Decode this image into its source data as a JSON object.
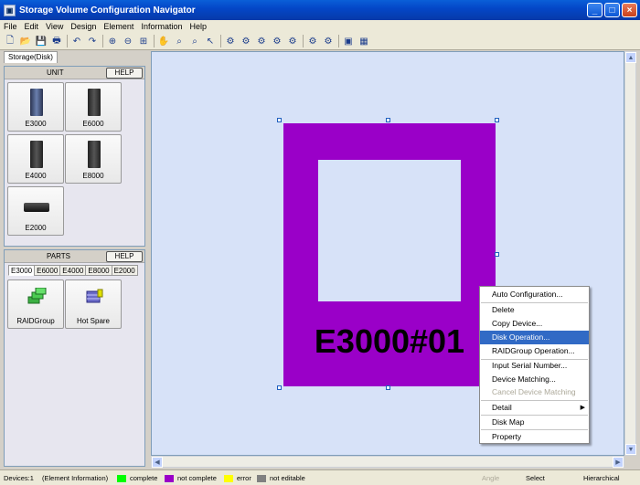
{
  "window": {
    "title": "Storage Volume Configuration Navigator",
    "min": "_",
    "max": "□",
    "close": "×"
  },
  "menu": [
    "File",
    "Edit",
    "View",
    "Design",
    "Element",
    "Information",
    "Help"
  ],
  "tab": "Storage(Disk)",
  "unit_panel": {
    "title": "UNIT",
    "help": "HELP",
    "items": [
      "E3000",
      "E6000",
      "E4000",
      "E8000",
      "E2000"
    ]
  },
  "parts_panel": {
    "title": "PARTS",
    "help": "HELP",
    "tabs": [
      "E3000",
      "E6000",
      "E4000",
      "E8000",
      "E2000"
    ],
    "items": [
      "RAIDGroup",
      "Hot Spare"
    ]
  },
  "canvas": {
    "device_label": "E3000#01",
    "device_color": "#9a00c8"
  },
  "context_menu": {
    "items": [
      "Auto Configuration...",
      "Delete",
      "Copy Device...",
      "Disk Operation...",
      "RAIDGroup Operation...",
      "Input Serial Number...",
      "Device Matching...",
      "Cancel Device Matching",
      "Detail",
      "Disk Map",
      "Property"
    ],
    "highlighted": "Disk Operation...",
    "disabled": "Cancel Device Matching",
    "submenu": "Detail"
  },
  "status": {
    "devices": "Devices:1",
    "info": "(Element Information)",
    "legend": [
      {
        "label": "complete",
        "color": "#00ff00"
      },
      {
        "label": "not complete",
        "color": "#9a00c8"
      },
      {
        "label": "error",
        "color": "#ffff00"
      },
      {
        "label": "not editable",
        "color": "#808080"
      }
    ],
    "angle": "Angle",
    "mode": "Select",
    "layout": "Hierarchical"
  }
}
